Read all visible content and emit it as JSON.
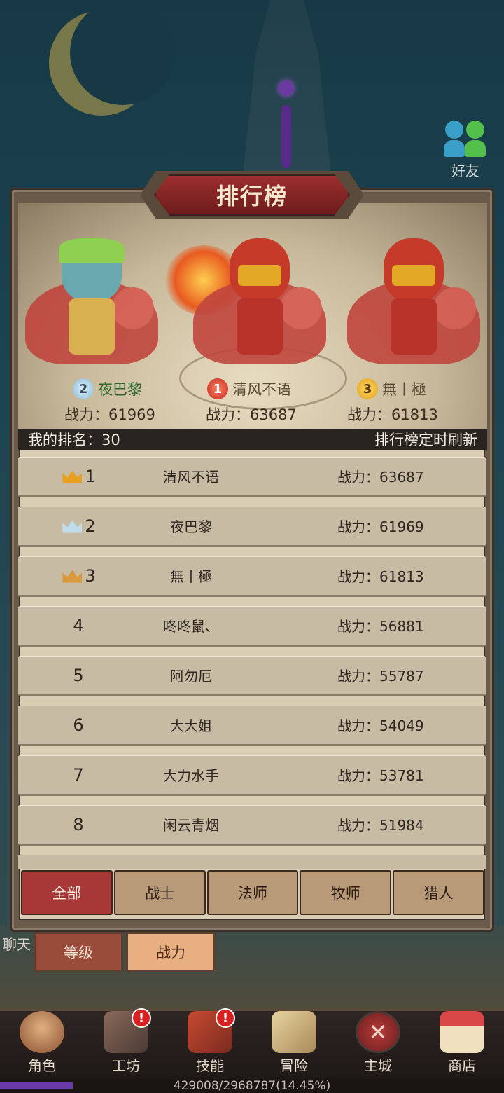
{
  "friends": {
    "label": "好友"
  },
  "panel": {
    "title": "排行榜"
  },
  "podium": [
    {
      "rank": "2",
      "name": "夜巴黎",
      "power_label": "战力：61969"
    },
    {
      "rank": "1",
      "name": "清风不语",
      "power_label": "战力：63687"
    },
    {
      "rank": "3",
      "name": "無丨極",
      "power_label": "战力：61813"
    }
  ],
  "my_rank": {
    "label": "我的排名：30",
    "refresh_note": "排行榜定时刷新"
  },
  "ranking": [
    {
      "rank": "1",
      "name": "清风不语",
      "power": "战力：63687",
      "crown": "gold"
    },
    {
      "rank": "2",
      "name": "夜巴黎",
      "power": "战力：61969",
      "crown": "silver"
    },
    {
      "rank": "3",
      "name": "無丨極",
      "power": "战力：61813",
      "crown": "bronze"
    },
    {
      "rank": "4",
      "name": "咚咚鼠、",
      "power": "战力：56881"
    },
    {
      "rank": "5",
      "name": "阿勿厄",
      "power": "战力：55787"
    },
    {
      "rank": "6",
      "name": "大大姐",
      "power": "战力：54049"
    },
    {
      "rank": "7",
      "name": "大力水手",
      "power": "战力：53781"
    },
    {
      "rank": "8",
      "name": "闲云青烟",
      "power": "战力：51984"
    }
  ],
  "class_tabs": [
    {
      "label": "全部",
      "active": true
    },
    {
      "label": "战士",
      "active": false
    },
    {
      "label": "法师",
      "active": false
    },
    {
      "label": "牧师",
      "active": false
    },
    {
      "label": "猎人",
      "active": false
    }
  ],
  "sort_tabs": {
    "level": "等级",
    "power": "战力"
  },
  "chat": {
    "label": "聊天"
  },
  "nav": [
    {
      "label": "角色",
      "icon": "character-icon",
      "alert": false
    },
    {
      "label": "工坊",
      "icon": "workshop-icon",
      "alert": true
    },
    {
      "label": "技能",
      "icon": "skill-book-icon",
      "alert": true
    },
    {
      "label": "冒险",
      "icon": "adventure-map-icon",
      "alert": false
    },
    {
      "label": "主城",
      "icon": "main-city-icon",
      "alert": false
    },
    {
      "label": "商店",
      "icon": "shop-icon",
      "alert": false
    }
  ],
  "exp": {
    "text": "429008/2968787(14.45%)",
    "progress_percent": 14.45
  },
  "colors": {
    "accent_red": "#a83838",
    "panel_bg": "#d9cdb4",
    "row_bg": "#c8bba4",
    "exp_purple": "#6a3aa8"
  }
}
